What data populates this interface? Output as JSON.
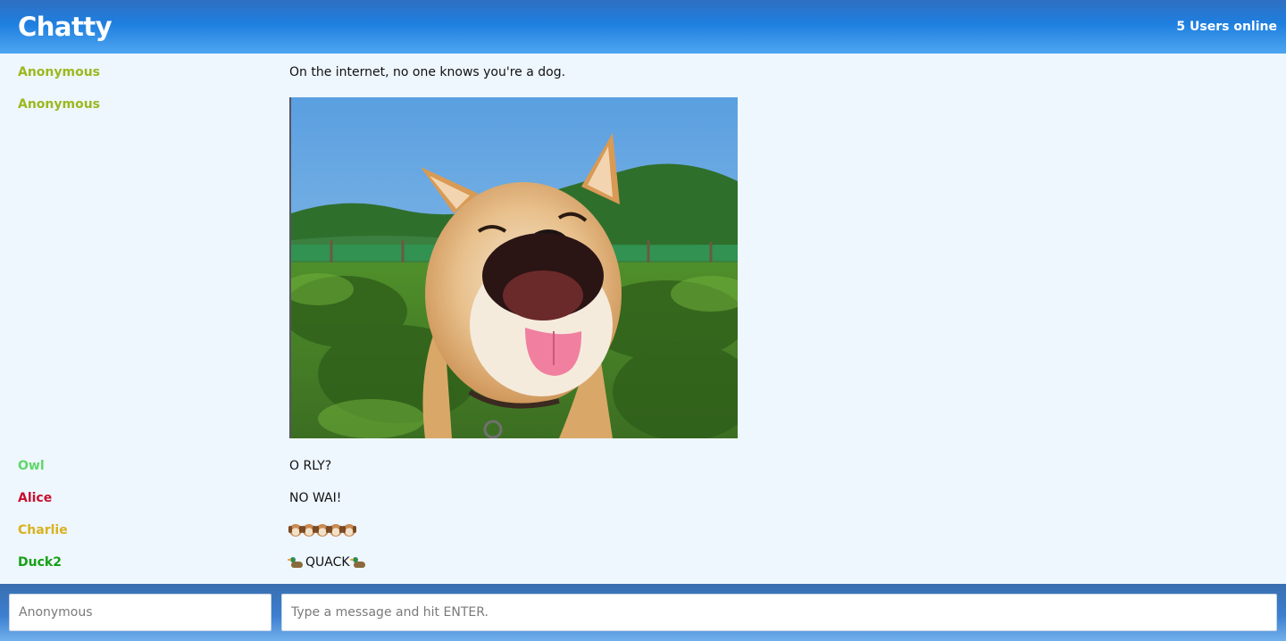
{
  "navbar": {
    "brand": "Chatty",
    "users_online": "5 Users online"
  },
  "messages": [
    {
      "username": "Anonymous",
      "color": "#9cb81e",
      "text": "On the internet, no one knows you're a dog."
    },
    {
      "username": "Anonymous",
      "color": "#9cb81e",
      "image": "smiling-shiba-dog-photo"
    },
    {
      "username": "Owl",
      "color": "#5fd86a",
      "text": "O RLY?"
    },
    {
      "username": "Alice",
      "color": "#c8102e",
      "text": "NO WAI!"
    },
    {
      "username": "Charlie",
      "color": "#d8b21e",
      "emoji": [
        "dog-emoji",
        "dog-emoji",
        "dog-emoji",
        "dog-emoji",
        "dog-emoji"
      ]
    },
    {
      "username": "Duck2",
      "color": "#17a017",
      "text": "QUACK",
      "emoji": [
        "duck-emoji",
        "duck-emoji"
      ]
    }
  ],
  "composer": {
    "username_placeholder": "Anonymous",
    "username_value": "",
    "message_placeholder": "Type a message and hit ENTER.",
    "message_value": ""
  },
  "colors": {
    "navbar_top": "#2f6fc2",
    "navbar_bottom": "#4ea6f0",
    "page_background": "#eef6fe"
  }
}
